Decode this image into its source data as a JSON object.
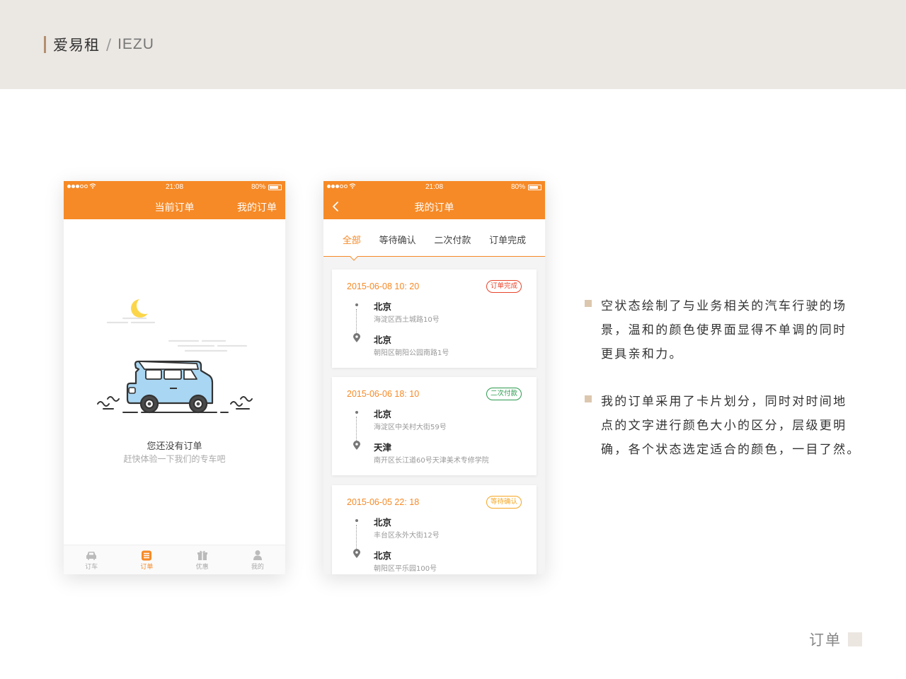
{
  "header": {
    "brand_cn": "爱易租",
    "separator": "/",
    "brand_en": "IEZU"
  },
  "colors": {
    "accent": "#f68a27",
    "header_band": "#ebe7e3",
    "bullet": "#dcc7ae",
    "status_done": "#e8442b",
    "status_second_payment": "#2c9a4f",
    "status_pending": "#f5a623"
  },
  "phone1": {
    "status_bar": {
      "time": "21:08",
      "battery": "80%",
      "battery_level": 0.8
    },
    "nav": {
      "title": "当前订单",
      "right_action": "我的订单"
    },
    "empty_state": {
      "illustration": "car-driving-night-illustration",
      "title": "您还没有订单",
      "subtitle": "赶快体验一下我们的专车吧"
    },
    "tabbar": [
      {
        "label": "订车",
        "icon": "car-icon",
        "active": false
      },
      {
        "label": "订单",
        "icon": "order-list-icon",
        "active": true
      },
      {
        "label": "优惠",
        "icon": "gift-icon",
        "active": false
      },
      {
        "label": "我的",
        "icon": "user-icon",
        "active": false
      }
    ]
  },
  "phone2": {
    "status_bar": {
      "time": "21:08",
      "battery": "80%",
      "battery_level": 0.8
    },
    "nav": {
      "title": "我的订单",
      "back_icon": "back-arrow-icon"
    },
    "filters": [
      "全部",
      "等待确认",
      "二次付款",
      "订单完成"
    ],
    "active_filter": "全部",
    "orders": [
      {
        "time": "2015-06-08 10: 20",
        "status": "订单完成",
        "status_color": "#e8442b",
        "from_city": "北京",
        "from_addr": "海淀区西土城路10号",
        "to_city": "北京",
        "to_addr": "朝阳区朝阳公园南路1号"
      },
      {
        "time": "2015-06-06 18: 10",
        "status": "二次付款",
        "status_color": "#2c9a4f",
        "from_city": "北京",
        "from_addr": "海淀区中关村大街59号",
        "to_city": "天津",
        "to_addr": "南开区长江道60号天津美术专修学院"
      },
      {
        "time": "2015-06-05 22: 18",
        "status": "等待确认",
        "status_color": "#f5a623",
        "from_city": "北京",
        "from_addr": "丰台区永外大街12号",
        "to_city": "北京",
        "to_addr": "朝阳区平乐园100号"
      }
    ]
  },
  "description": [
    {
      "lines": [
        "空状态绘制了与业务相关的汽车行驶的场",
        "景，温和的颜色使界面显得不单调的同时",
        "更具亲和力。"
      ]
    },
    {
      "lines": [
        "我的订单采用了卡片划分，同时对时间地",
        "点的文字进行颜色大小的区分，层级更明",
        "确，各个状态选定适合的颜色，一目了然。"
      ]
    }
  ],
  "footer": {
    "label": "订单"
  }
}
